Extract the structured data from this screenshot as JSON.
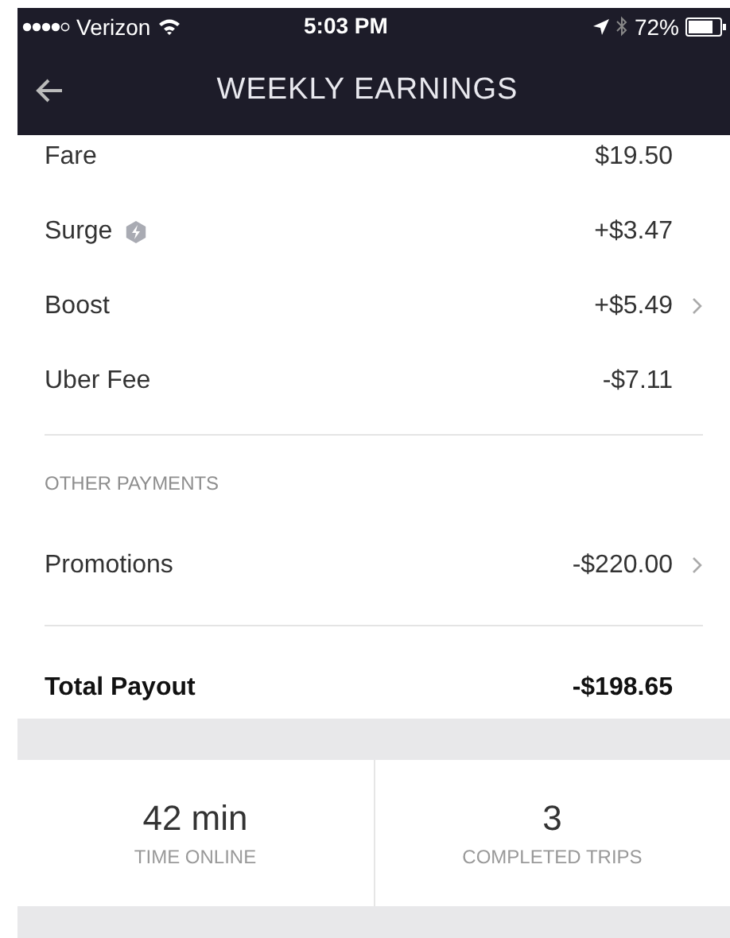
{
  "status_bar": {
    "carrier": "Verizon",
    "time": "5:03 PM",
    "battery": "72%"
  },
  "nav": {
    "title": "WEEKLY EARNINGS"
  },
  "breakdown": [
    {
      "label": "Fare",
      "amount": "$19.50",
      "surge_icon": false,
      "chevron": false
    },
    {
      "label": "Surge",
      "amount": "+$3.47",
      "surge_icon": true,
      "chevron": false
    },
    {
      "label": "Boost",
      "amount": "+$5.49",
      "surge_icon": false,
      "chevron": true
    },
    {
      "label": "Uber Fee",
      "amount": "-$7.11",
      "surge_icon": false,
      "chevron": false
    }
  ],
  "other_payments": {
    "heading": "OTHER PAYMENTS",
    "rows": [
      {
        "label": "Promotions",
        "amount": "-$220.00",
        "surge_icon": false,
        "chevron": true
      }
    ]
  },
  "total": {
    "label": "Total Payout",
    "amount": "-$198.65"
  },
  "stats": [
    {
      "value": "42 min",
      "label": "TIME ONLINE"
    },
    {
      "value": "3",
      "label": "COMPLETED TRIPS"
    }
  ]
}
